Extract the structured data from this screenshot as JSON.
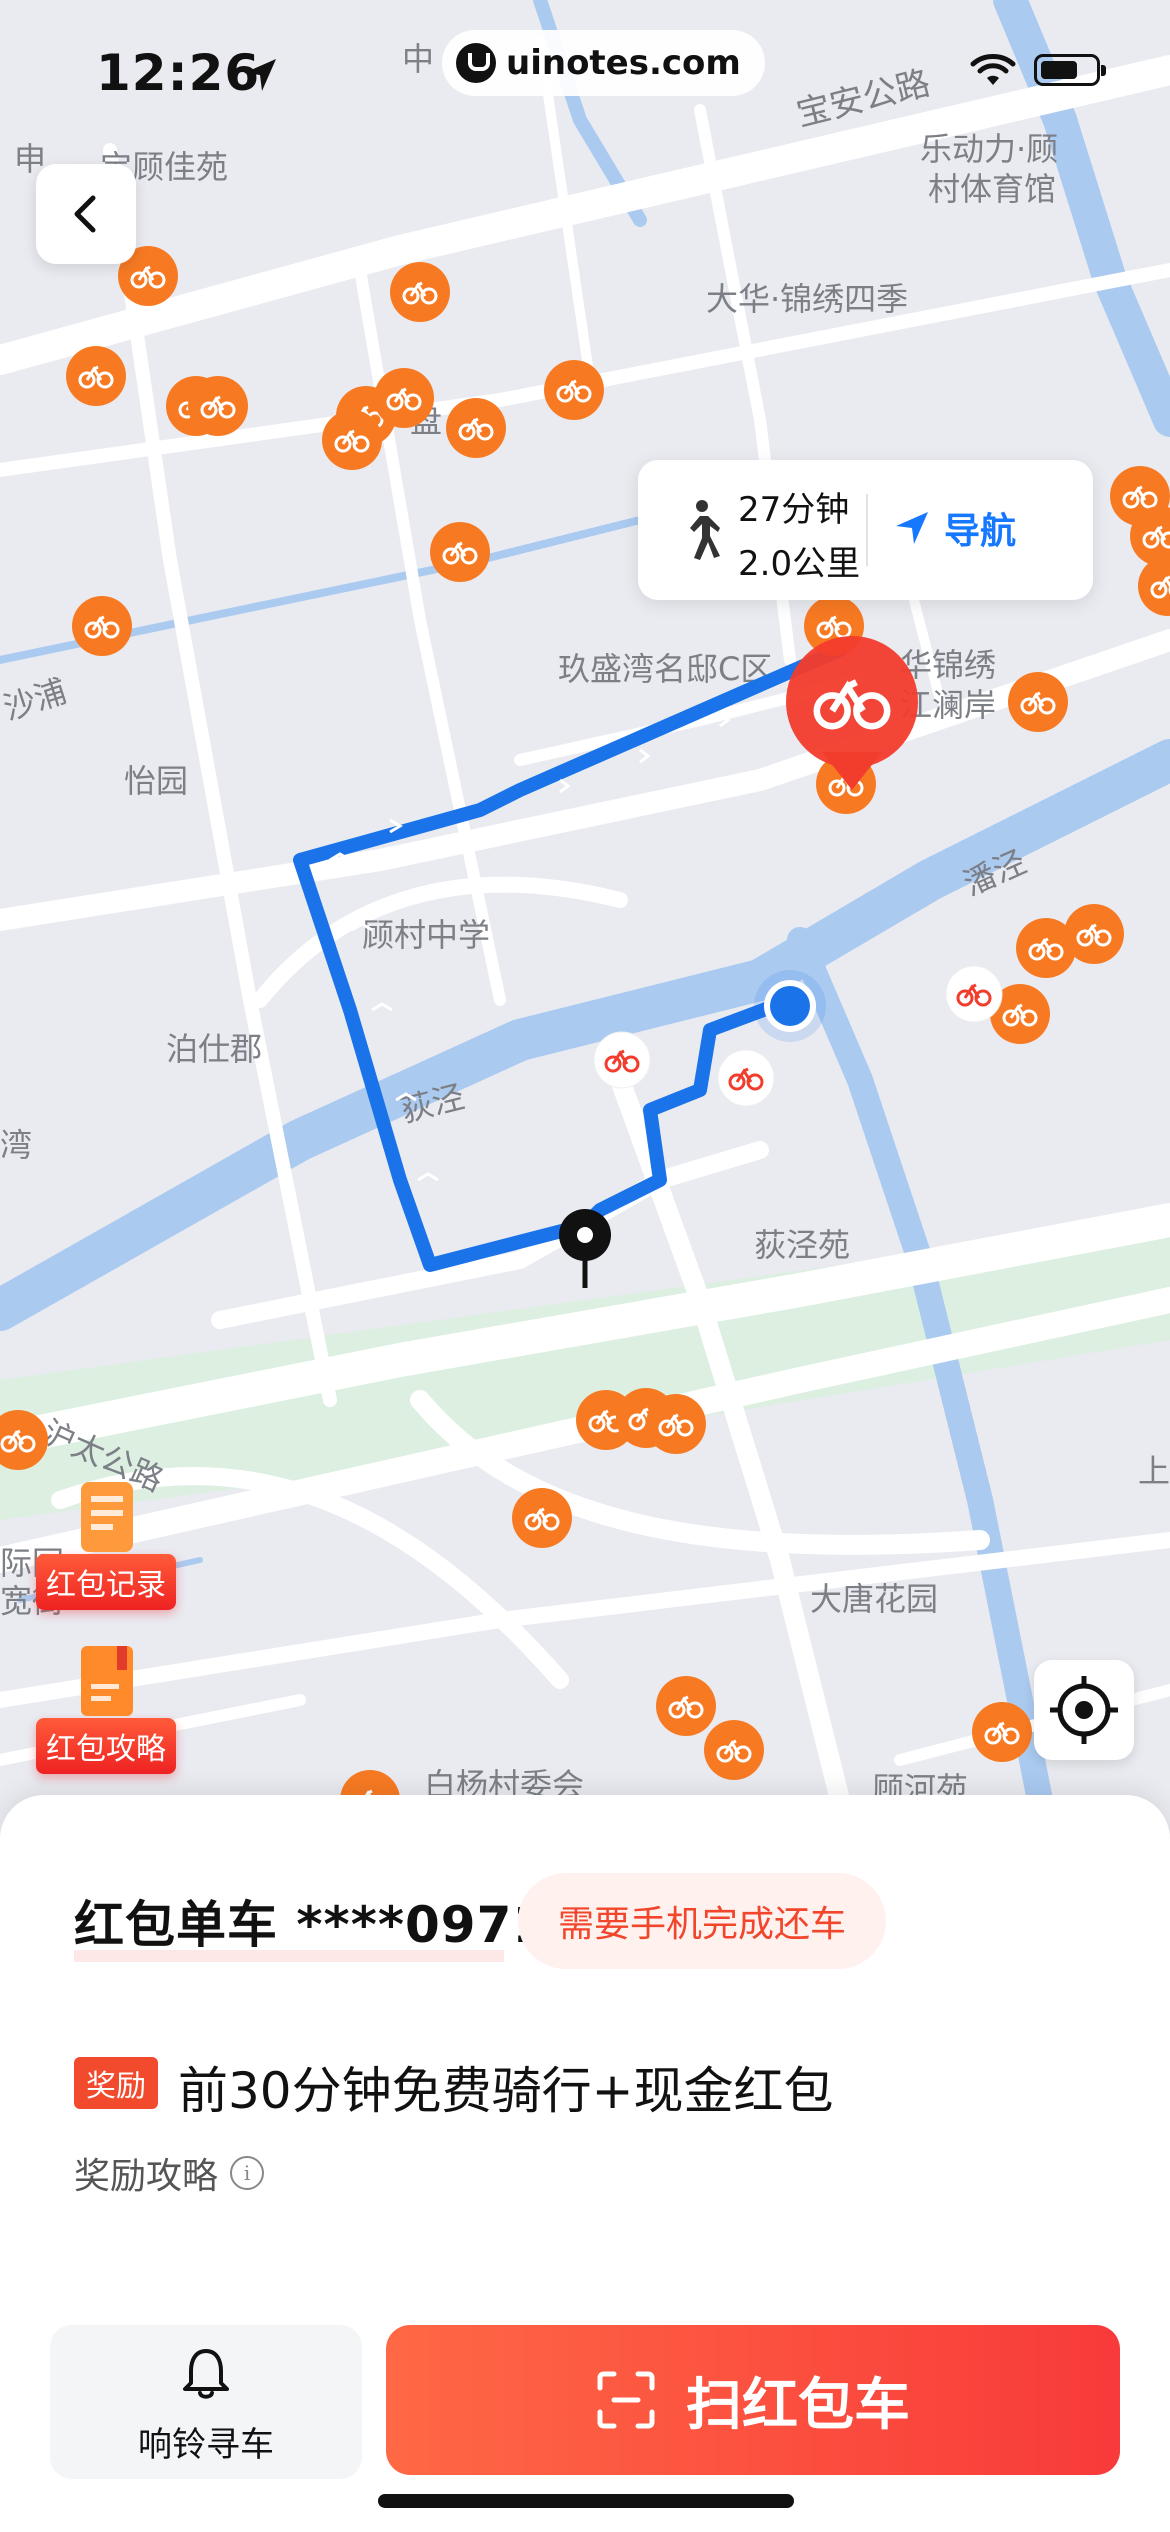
{
  "status_bar": {
    "time": "12:26",
    "watermark": "uinotes.com"
  },
  "map": {
    "labels": [
      {
        "text": "中",
        "style": "lbl"
      },
      {
        "text": "宝安公路",
        "style": "road"
      },
      {
        "text": "乐动力·顾",
        "style": "lbl"
      },
      {
        "text": "村体育馆",
        "style": "lbl"
      },
      {
        "text": "申",
        "style": "lbl"
      },
      {
        "text": "宝顾佳苑",
        "style": "lbl"
      },
      {
        "text": "大华·锦绣四季",
        "style": "lbl"
      },
      {
        "text": "盘",
        "style": "lbl"
      },
      {
        "text": "沙浦",
        "style": "road"
      },
      {
        "text": "玖盛湾名邸C区",
        "style": "lbl"
      },
      {
        "text": "华锦绣",
        "style": "lbl"
      },
      {
        "text": "江澜岸",
        "style": "lbl"
      },
      {
        "text": "怡园",
        "style": "lbl"
      },
      {
        "text": "潘泾",
        "style": "road"
      },
      {
        "text": "顾村中学",
        "style": "lbl"
      },
      {
        "text": "泊仕郡",
        "style": "lbl"
      },
      {
        "text": "荻泾",
        "style": "road"
      },
      {
        "text": "湾",
        "style": "lbl"
      },
      {
        "text": "荻泾苑",
        "style": "lbl"
      },
      {
        "text": "沪太公路",
        "style": "road"
      },
      {
        "text": "际园",
        "style": "lbl"
      },
      {
        "text": "宽街",
        "style": "lbl"
      },
      {
        "text": "上",
        "style": "lbl"
      },
      {
        "text": "大唐花园",
        "style": "lbl"
      },
      {
        "text": "白杨村委会",
        "style": "lbl"
      },
      {
        "text": "顾河苑",
        "style": "lbl"
      }
    ]
  },
  "nav_card": {
    "duration": "27分钟",
    "distance": "2.0公里",
    "navigate_label": "导航"
  },
  "side_buttons": {
    "records_label": "红包记录",
    "guide_label": "红包攻略"
  },
  "sheet": {
    "bike_title": "红包单车 ****0971",
    "return_tag": "需要手机完成还车",
    "reward_badge": "奖励",
    "reward_text": "前30分钟免费骑行+现金红包",
    "guide_link": "奖励攻略",
    "bell_label": "响铃寻车",
    "scan_label": "扫红包车"
  },
  "colors": {
    "accent": "#f83a3a",
    "route": "#1a73e8",
    "nav": "#1677ff",
    "bike_marker": "#f77a23",
    "map_bg": "#e9ebf1",
    "water": "#abcaf0",
    "green": "#dcefe1"
  }
}
